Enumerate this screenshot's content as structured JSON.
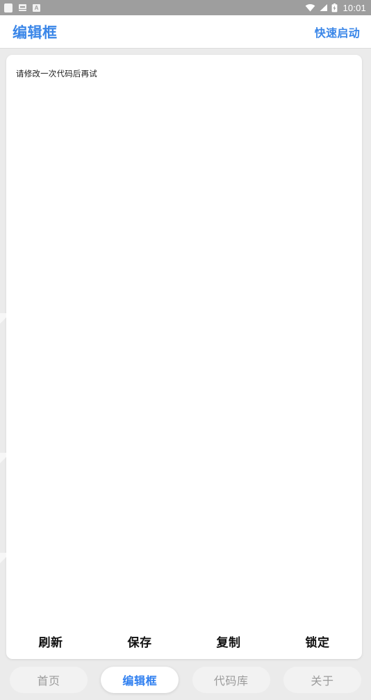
{
  "status_bar": {
    "notification_icons": [
      "blank-app-icon",
      "screenshot-icon",
      "letter-a-icon"
    ],
    "system_icons": [
      "wifi-icon",
      "signal-icon",
      "battery-charging-icon"
    ],
    "time": "10:01",
    "background_color": "#9e9e9e",
    "foreground_color": "#ffffff"
  },
  "header": {
    "title": "编辑框",
    "action_label": "快速启动",
    "accent_color": "#3a86e8"
  },
  "editor": {
    "content": "请修改一次代码后再试",
    "placeholder": "请修改一次代码后再试"
  },
  "actions": [
    {
      "label": "刷新",
      "name": "refresh"
    },
    {
      "label": "保存",
      "name": "save"
    },
    {
      "label": "复制",
      "name": "copy"
    },
    {
      "label": "锁定",
      "name": "lock"
    }
  ],
  "tabs": [
    {
      "label": "首页",
      "name": "home",
      "active": false
    },
    {
      "label": "编辑框",
      "name": "editor",
      "active": true
    },
    {
      "label": "代码库",
      "name": "code-library",
      "active": false
    },
    {
      "label": "关于",
      "name": "about",
      "active": false
    }
  ],
  "colors": {
    "page_background": "#ebebeb",
    "card_background": "#ffffff",
    "accent": "#3a86e8",
    "tab_active_text": "#2f7ff0",
    "tab_inactive_text": "#9b9b9b"
  }
}
